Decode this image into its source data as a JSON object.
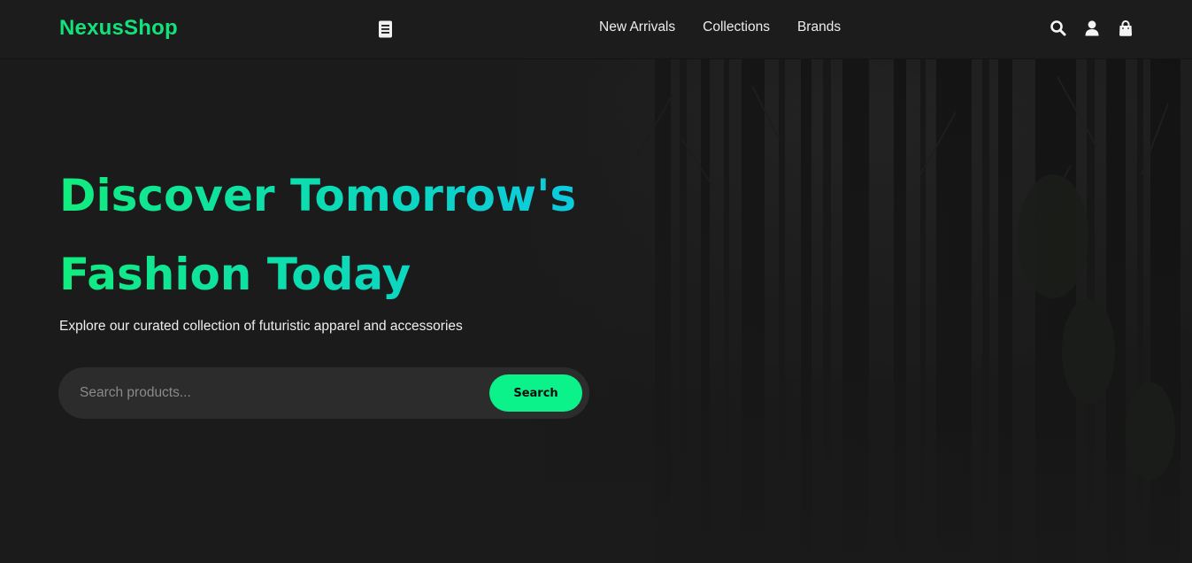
{
  "brand": {
    "name": "NexusShop"
  },
  "nav": {
    "links": [
      "New Arrivals",
      "Collections",
      "Brands"
    ],
    "icons": [
      "search-icon",
      "user-icon",
      "shopping-bag-icon"
    ]
  },
  "hero": {
    "title_line1": "Discover Tomorrow's",
    "title_line2": "Fashion Today",
    "subtitle": "Explore our curated collection of futuristic apparel and accessories"
  },
  "search": {
    "placeholder": "Search products...",
    "value": "",
    "button_label": "Search"
  },
  "colors": {
    "accent": "#0bf28a",
    "logo": "#12e27a",
    "gradient_start": "#12ec7e",
    "gradient_end": "#0dc6e6",
    "background": "#1b1b1b",
    "navbar": "#1c1c1c"
  }
}
